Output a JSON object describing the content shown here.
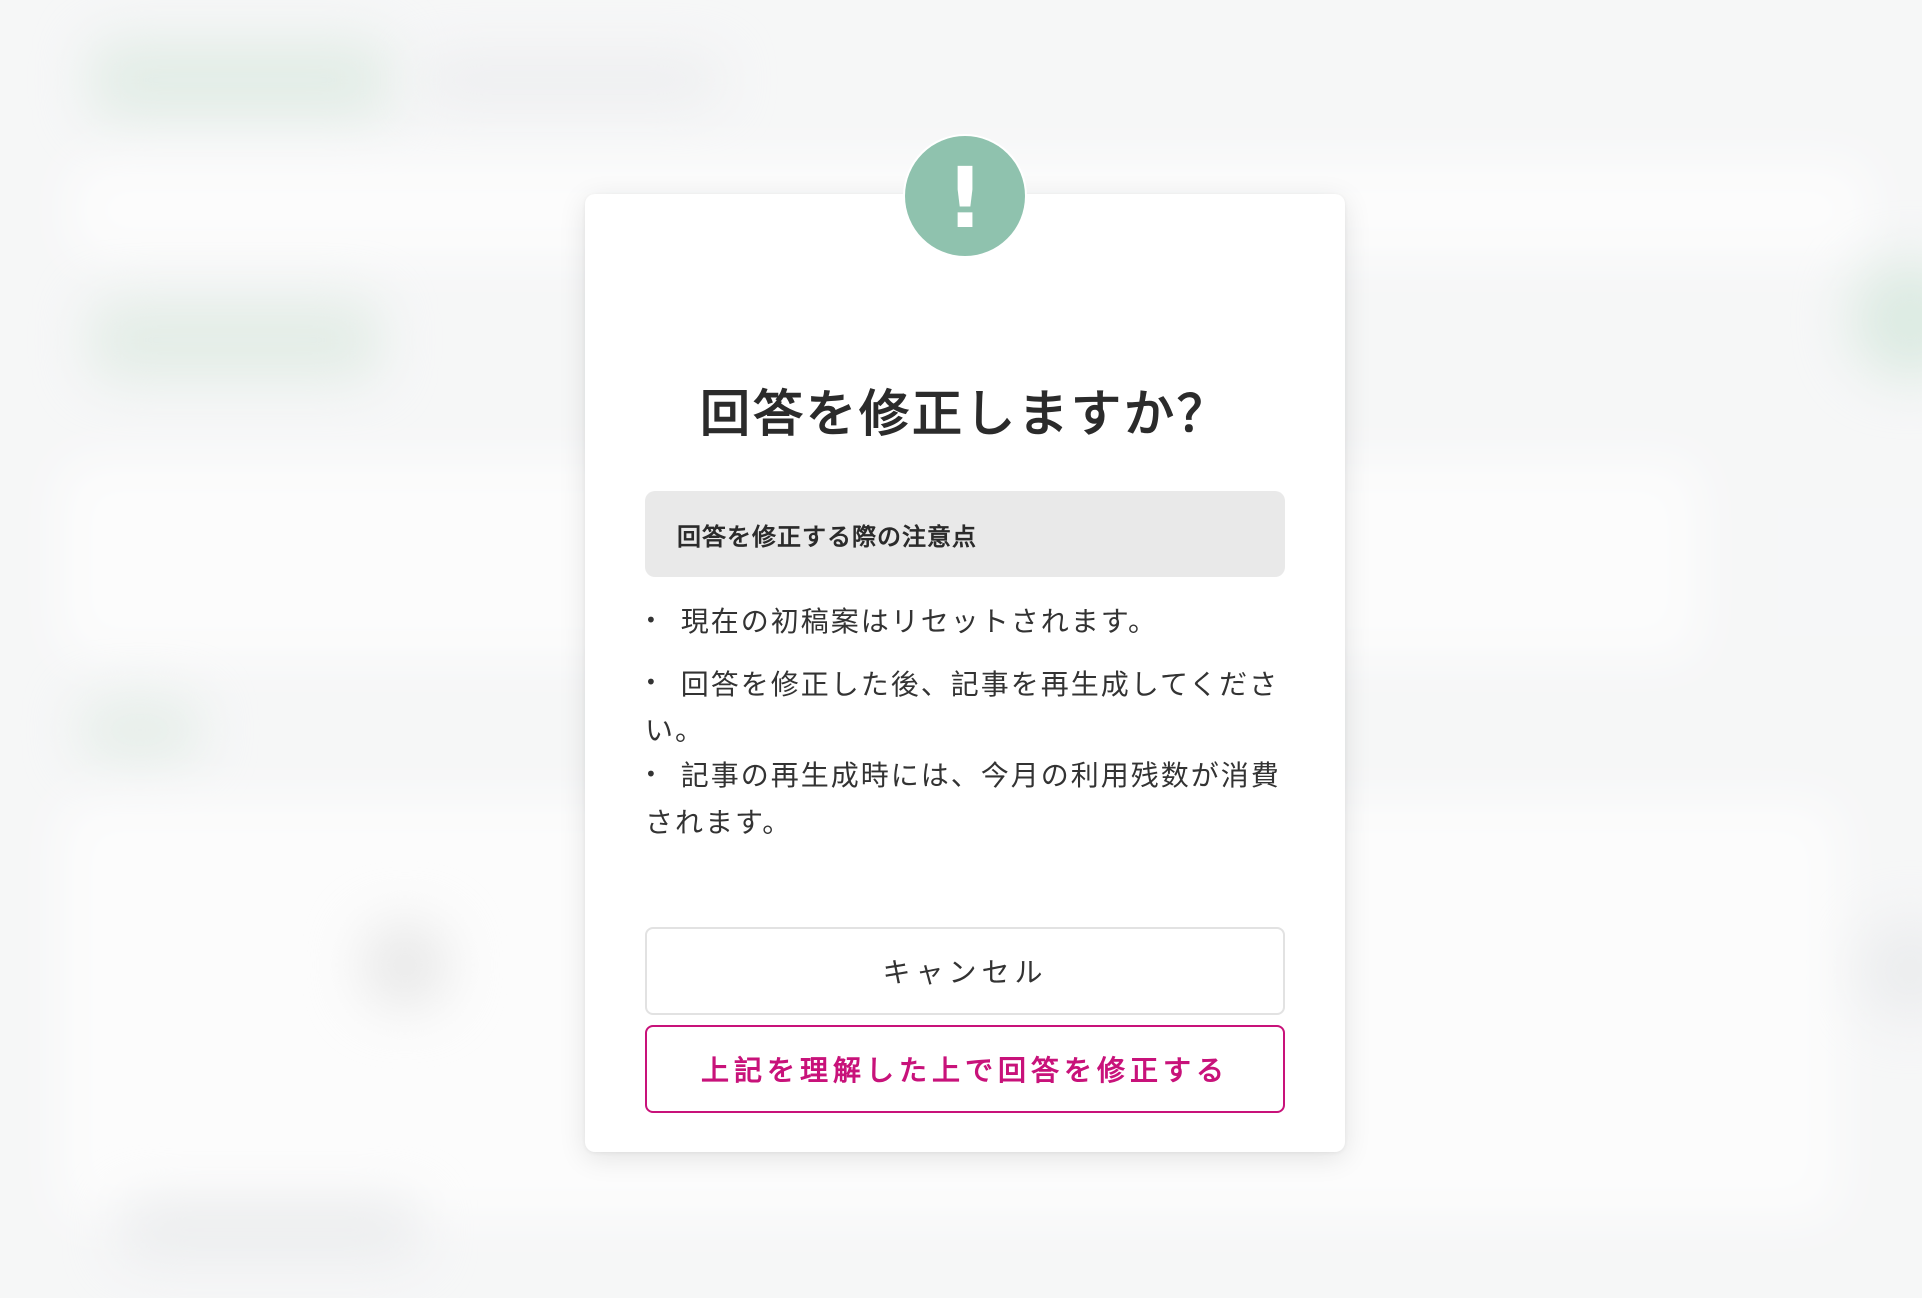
{
  "dialog": {
    "title": "回答を修正しますか？",
    "alert_symbol": "!",
    "notice_heading": "回答を修正する際の注意点",
    "bullets": [
      "現在の初稿案はリセットされます。",
      "回答を修正した後、記事を再生成してください。",
      "記事の再生成時には、今月の利用残数が消費されます。"
    ],
    "cancel_label": "キャンセル",
    "confirm_label": "上記を理解した上で回答を修正する"
  },
  "colors": {
    "accent_green": "#8fc2ae",
    "confirm_magenta": "#c8127a"
  }
}
